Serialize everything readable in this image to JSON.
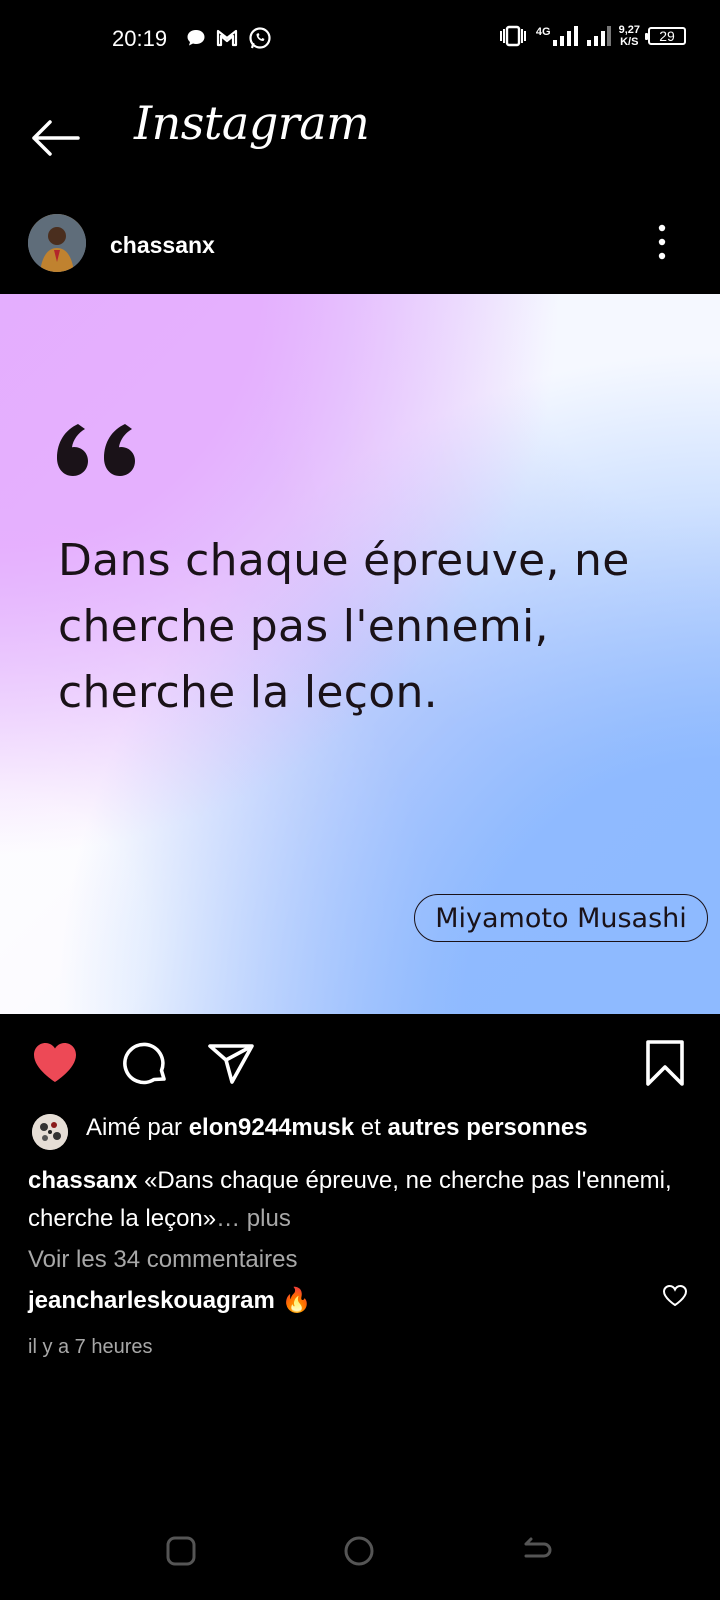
{
  "status_bar": {
    "time": "20:19",
    "net_rate_value": "9,27",
    "net_rate_unit": "K/S",
    "network": "4G",
    "battery": "29",
    "icons": [
      "chat-bubble-icon",
      "gmail-icon",
      "whatsapp-icon",
      "vibrate-icon",
      "signal-icon",
      "signal-icon"
    ]
  },
  "header": {
    "app_name": "Instagram",
    "back_icon": "back-arrow-icon"
  },
  "post": {
    "username": "chassanx",
    "menu_icon": "more-vertical-icon",
    "quote": "Dans chaque épreuve, ne cherche pas l'ennemi, cherche la leçon.",
    "author": "Miyamoto Musashi"
  },
  "actions": {
    "like_icon": "heart-icon",
    "comment_icon": "comment-icon",
    "share_icon": "send-icon",
    "save_icon": "bookmark-icon",
    "like_color": "#ed4956"
  },
  "likes": {
    "prefix": "Aimé par ",
    "user": "elon9244musk",
    "mid": " et ",
    "others": "autres personnes"
  },
  "caption": {
    "username": "chassanx",
    "text": " «Dans chaque épreuve, ne cherche pas l'ennemi, cherche la leçon»",
    "ellipsis": "…",
    "more": " plus"
  },
  "comments": {
    "view_all": "Voir les 34 commentaires",
    "first_user": "jeancharleskouagram",
    "first_text": " 🔥"
  },
  "time_ago": "il y a 7 heures",
  "nav": {
    "recent_icon": "recent-apps-icon",
    "home_icon": "home-circle-icon",
    "back_icon": "nav-back-icon"
  }
}
